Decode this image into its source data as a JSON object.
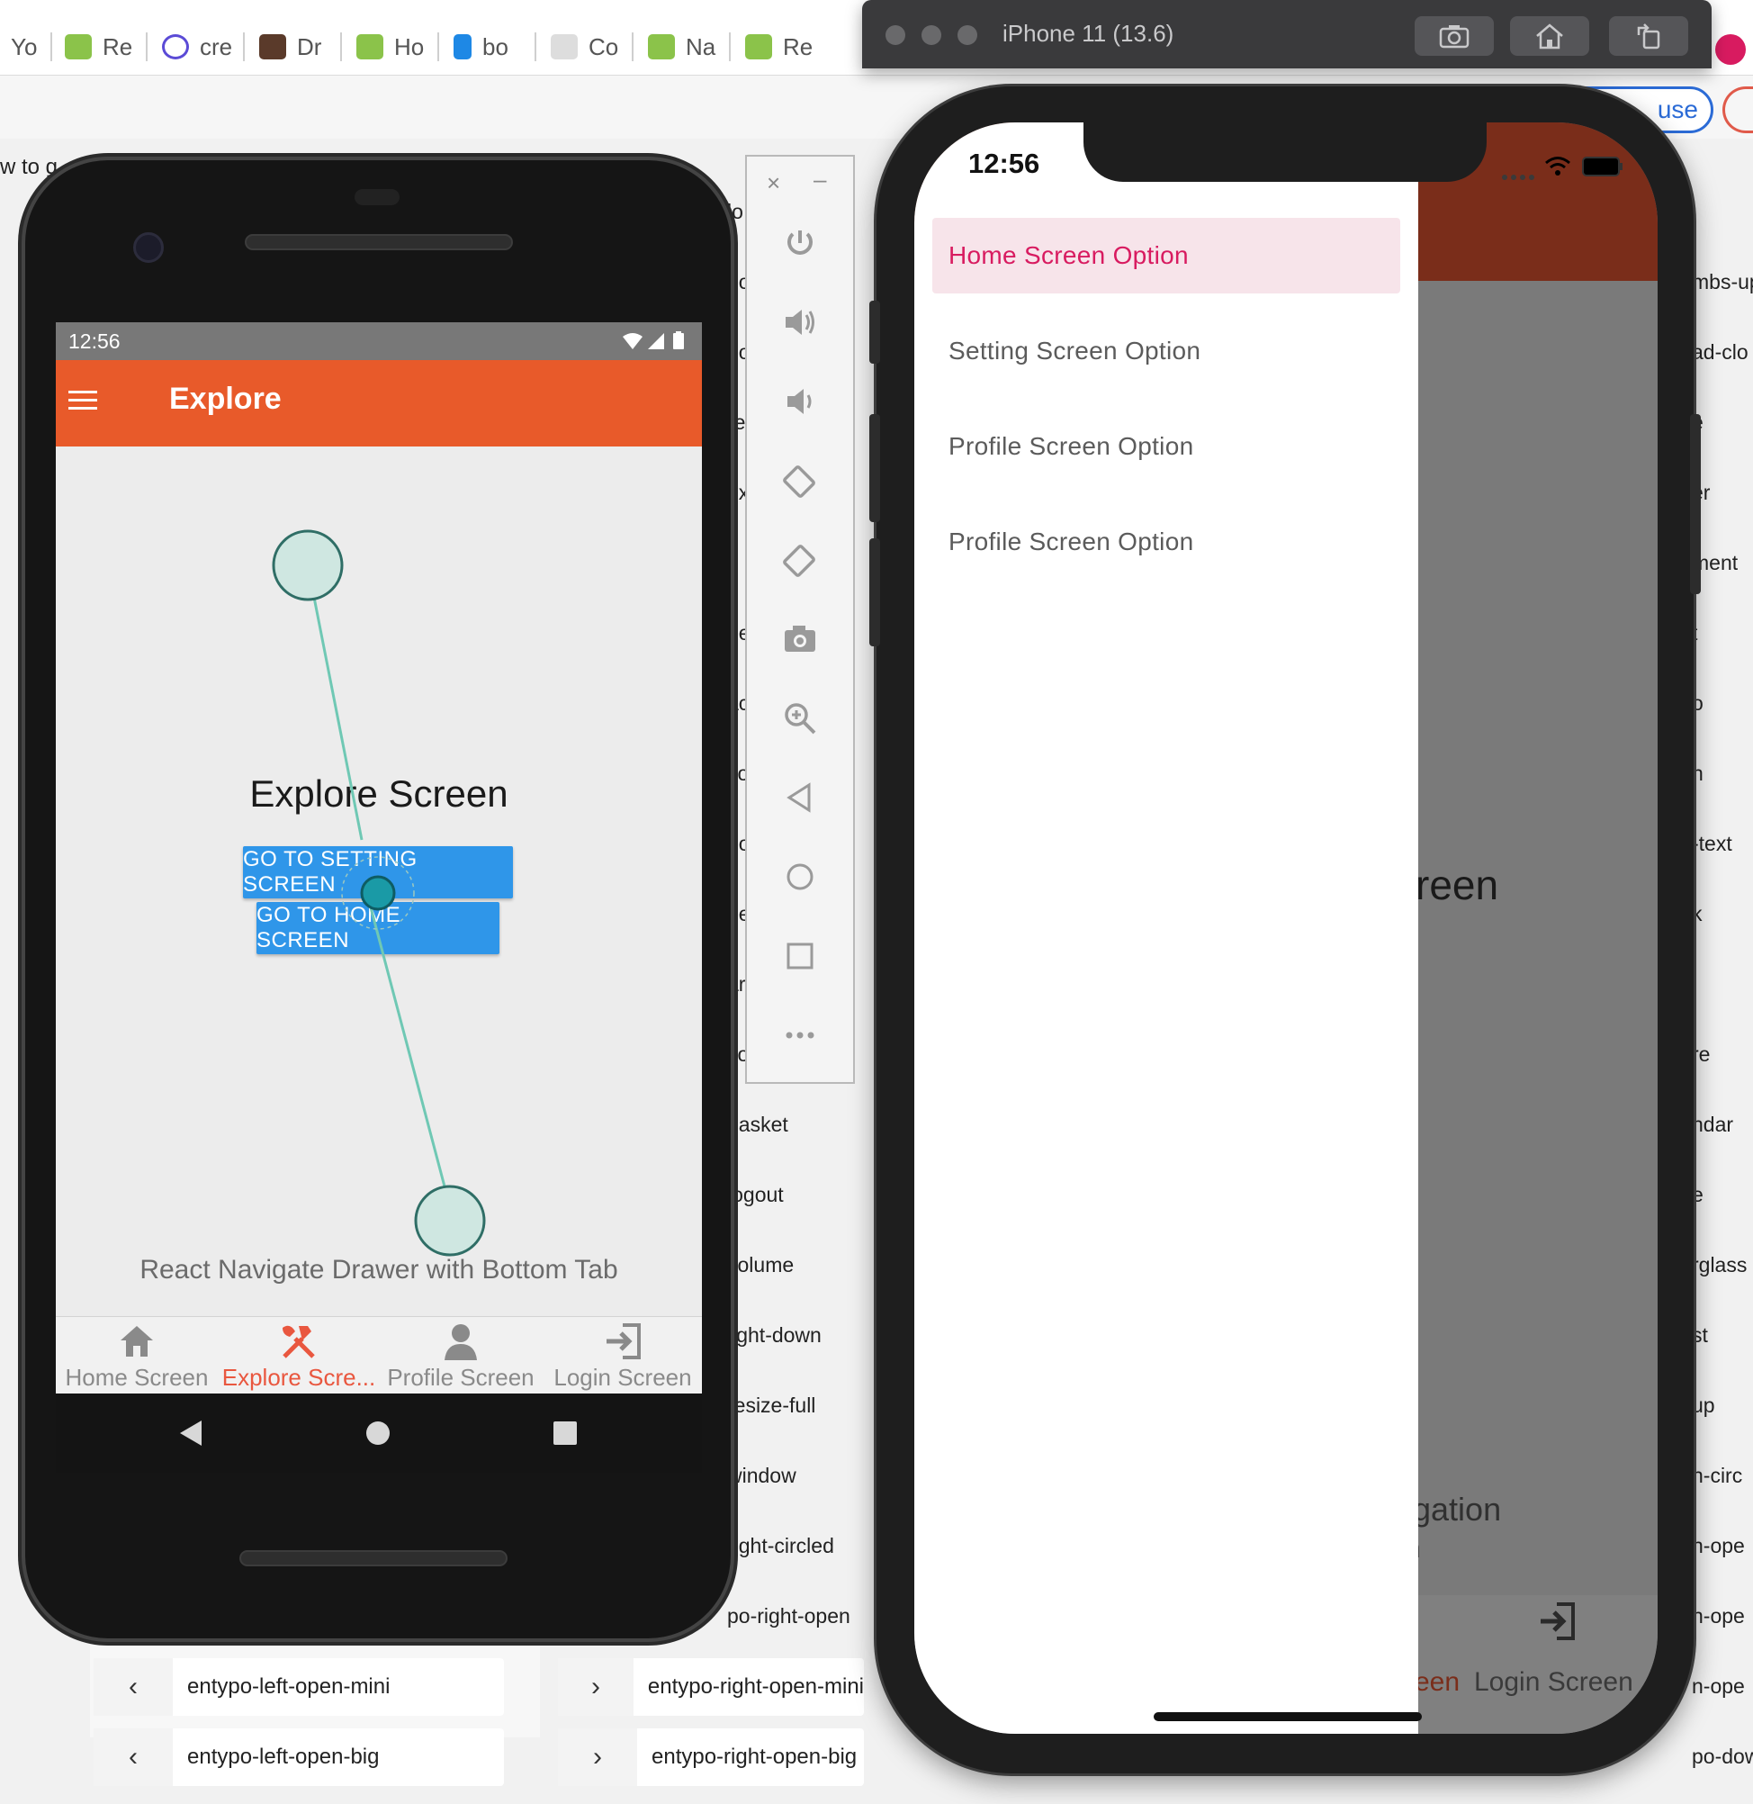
{
  "browser": {
    "tabs": [
      {
        "label": "Yo",
        "favicon_color": "#ffffff"
      },
      {
        "label": "Re",
        "favicon_color": "#8bc34a"
      },
      {
        "label": "cre",
        "favicon_color": "#5b4bd6"
      },
      {
        "label": "Dr",
        "favicon_color": "#5a3a2a"
      },
      {
        "label": "Ho",
        "favicon_color": "#8bc34a"
      },
      {
        "label": "bo",
        "favicon_color": "#1e88e5"
      },
      {
        "label": "Co",
        "favicon_color": "#333333"
      },
      {
        "label": "Na",
        "favicon_color": "#8bc34a"
      },
      {
        "label": "Re",
        "favicon_color": "#8bc34a"
      }
    ],
    "pill_label": "use",
    "left_fragment": "w to g",
    "middle_list": [
      "lo",
      "bo",
      "do",
      "re",
      "ex",
      "e",
      "be",
      "ac",
      "co",
      "do",
      "he",
      "ar",
      "co",
      "basket",
      "logout",
      "volume",
      "light-down",
      "resize-full",
      "window",
      "right-circled",
      "po-right-open"
    ],
    "right_list": [
      "mbs-up",
      "ad-clo",
      "e",
      "er",
      "ment",
      "t",
      "o",
      "h",
      "-text",
      "k",
      "re",
      "ndar",
      "e",
      "rglass",
      "st",
      "up",
      "n-circ",
      "n-ope",
      "n-ope",
      "n-ope",
      "po-down"
    ],
    "bottom_rows": [
      {
        "glyph": "‹",
        "label": "entypo-left-open-mini"
      },
      {
        "glyph": "›",
        "label": "entypo-right-open-mini"
      },
      {
        "glyph": "‹",
        "label": "entypo-left-open-big"
      },
      {
        "glyph": "›",
        "label": "entypo-right-open-big"
      }
    ]
  },
  "simulator": {
    "title": "iPhone 11 (13.6)",
    "buttons": [
      "screenshot-icon",
      "home-icon",
      "rotate-icon"
    ]
  },
  "ios": {
    "time": "12:56",
    "drawer_items": [
      {
        "label": "Home Screen Option",
        "active": true
      },
      {
        "label": "Setting Screen Option",
        "active": false
      },
      {
        "label": "Profile Screen Option",
        "active": false
      },
      {
        "label": "Profile Screen Option",
        "active": false
      }
    ],
    "behind_heading": "creen",
    "behind_caption": "igation",
    "behind_caption2": "n",
    "behind_tab_partial": "reen",
    "behind_tab_login": "Login Screen",
    "accent_color": "#d81b60",
    "header_color": "#7a2d1a"
  },
  "emulator_toolbar": {
    "tools": [
      "power-icon",
      "volume-up-icon",
      "volume-down-icon",
      "rotate-left-icon",
      "rotate-right-icon",
      "camera-icon",
      "zoom-icon",
      "back-icon",
      "home-icon",
      "overview-icon",
      "more-icon"
    ]
  },
  "android": {
    "time": "12:56",
    "appbar_title": "Explore",
    "heading": "Explore Screen",
    "buttons": {
      "setting": "GO TO SETTING SCREEN",
      "home": "GO TO HOME SCREEN"
    },
    "caption": "React Navigate Drawer with Bottom Tab",
    "tabs": [
      {
        "label": "Home Screen",
        "icon": "home-icon",
        "active": false
      },
      {
        "label": "Explore Scre...",
        "icon": "tools-icon",
        "active": true
      },
      {
        "label": "Profile Screen",
        "icon": "user-icon",
        "active": false
      },
      {
        "label": "Login Screen",
        "icon": "login-icon",
        "active": false
      }
    ],
    "appbar_color": "#e85a2a",
    "active_tab_color": "#e9573f",
    "button_color": "#2f96e9"
  }
}
